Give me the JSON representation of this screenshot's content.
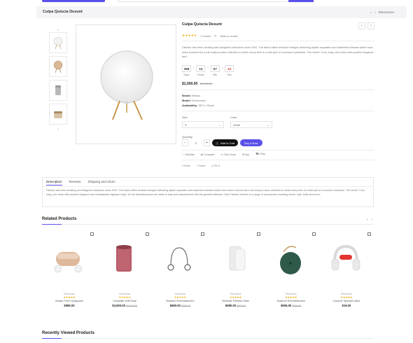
{
  "header": {
    "title": "Culpa Quiscia Desunt",
    "crumb_home": "⌂",
    "crumb_sep": "›",
    "crumb_category": "Electronics"
  },
  "thumbs": {
    "up": "˄",
    "down": "˅"
  },
  "product": {
    "title": "Culpa Quiscia Desunt",
    "prev": "‹",
    "next": "›",
    "stars": "★★★★★",
    "reviews": "1 review",
    "write_review": "Write a review",
    "description": "Fashion has been creating well-designed collections since 2010. The brand offers feminine designs delivering stylish separates and statement dresses which have since evolved into a full ready-to-wear collection in which every item is a vital part of a woman's wardrobe. The result? Cool, easy, chic looks with youthful elegance and...",
    "countdown": [
      {
        "value": "358",
        "label": "Days",
        "red": false
      },
      {
        "value": "13",
        "label": "Hours",
        "red": false
      },
      {
        "value": "57",
        "label": "Min",
        "red": false
      },
      {
        "value": "34",
        "label": "Sec",
        "red": true
      }
    ],
    "countdown_sep": ":",
    "price": "$1,500.00",
    "old_price": "$2,000.00",
    "brand_label": "Brand:",
    "brand": "Nelsus",
    "model_label": "Model:",
    "model": "Electronics",
    "availability_label": "Availability:",
    "availability": "367 In Stock",
    "size_label": "Size",
    "size_value": "S",
    "color_label": "Color",
    "color_value": "White",
    "quantity_label": "Quantity",
    "qty": "1",
    "minus": "−",
    "plus": "+",
    "add_to_cart": "Add to Cart",
    "buy_now": "Buy It Now",
    "actions": [
      "Wishlist",
      "Compare",
      "Size chart",
      "Ask",
      "Ship"
    ],
    "share": [
      "Share",
      "Tweet",
      "Pin it"
    ]
  },
  "tabs": {
    "items": [
      "Description",
      "Reviews",
      "Shipping and return"
    ],
    "text": "Fashion has been creating well-designed collections since 2010. The brand offers feminine designs delivering stylish separates and statement dresses which have since evolved into a full ready-to-wear collection in which every item is a vital part of a woman's wardrobe. The result? Cool, easy, chic looks with youthful elegance and unmistakable signature style. All the beautiful pieces are made in Italy and manufactured with the greatest attention. Now Fashion extends to a range of accessories including shoes, hats, belts and more!"
  },
  "related": {
    "title": "Related Products",
    "prev": "‹",
    "next": "›",
    "items": [
      {
        "category": "Electronics",
        "stars": "★★★★★",
        "name": "Neque Porro Quisquam",
        "price": "$580.00",
        "old": "",
        "art": "earbuds"
      },
      {
        "category": "Electronics",
        "stars": "★★★★★",
        "name": "Voluptate Velit Esse",
        "price": "$3,600.00",
        "old": "$4,000.00",
        "art": "speaker"
      },
      {
        "category": "Electronics",
        "stars": "★★★★★",
        "name": "Nostrum Exercitationem",
        "price": "$680.00",
        "old": "$750.00",
        "art": "earphones"
      },
      {
        "category": "Electronics",
        "stars": "★★★★★",
        "name": "Molestie Pulentsi Vitae",
        "price": "$680.00",
        "old": "$800.00",
        "art": "charger"
      },
      {
        "category": "Electronics",
        "stars": "★★★★★",
        "name": "Nostrum Exercitationem",
        "price": "$506.00",
        "old": "$600.00",
        "art": "greenspeaker"
      },
      {
        "category": "Electronics",
        "stars": "★★★★★",
        "name": "Corporis Suscipit Labor",
        "price": "$16.00",
        "old": "",
        "art": "headphones"
      }
    ]
  },
  "recent": {
    "title": "Recently Viewed Products"
  },
  "colors": {
    "accent": "#5b50e8",
    "star": "#f0a500",
    "red": "#e3342f"
  }
}
